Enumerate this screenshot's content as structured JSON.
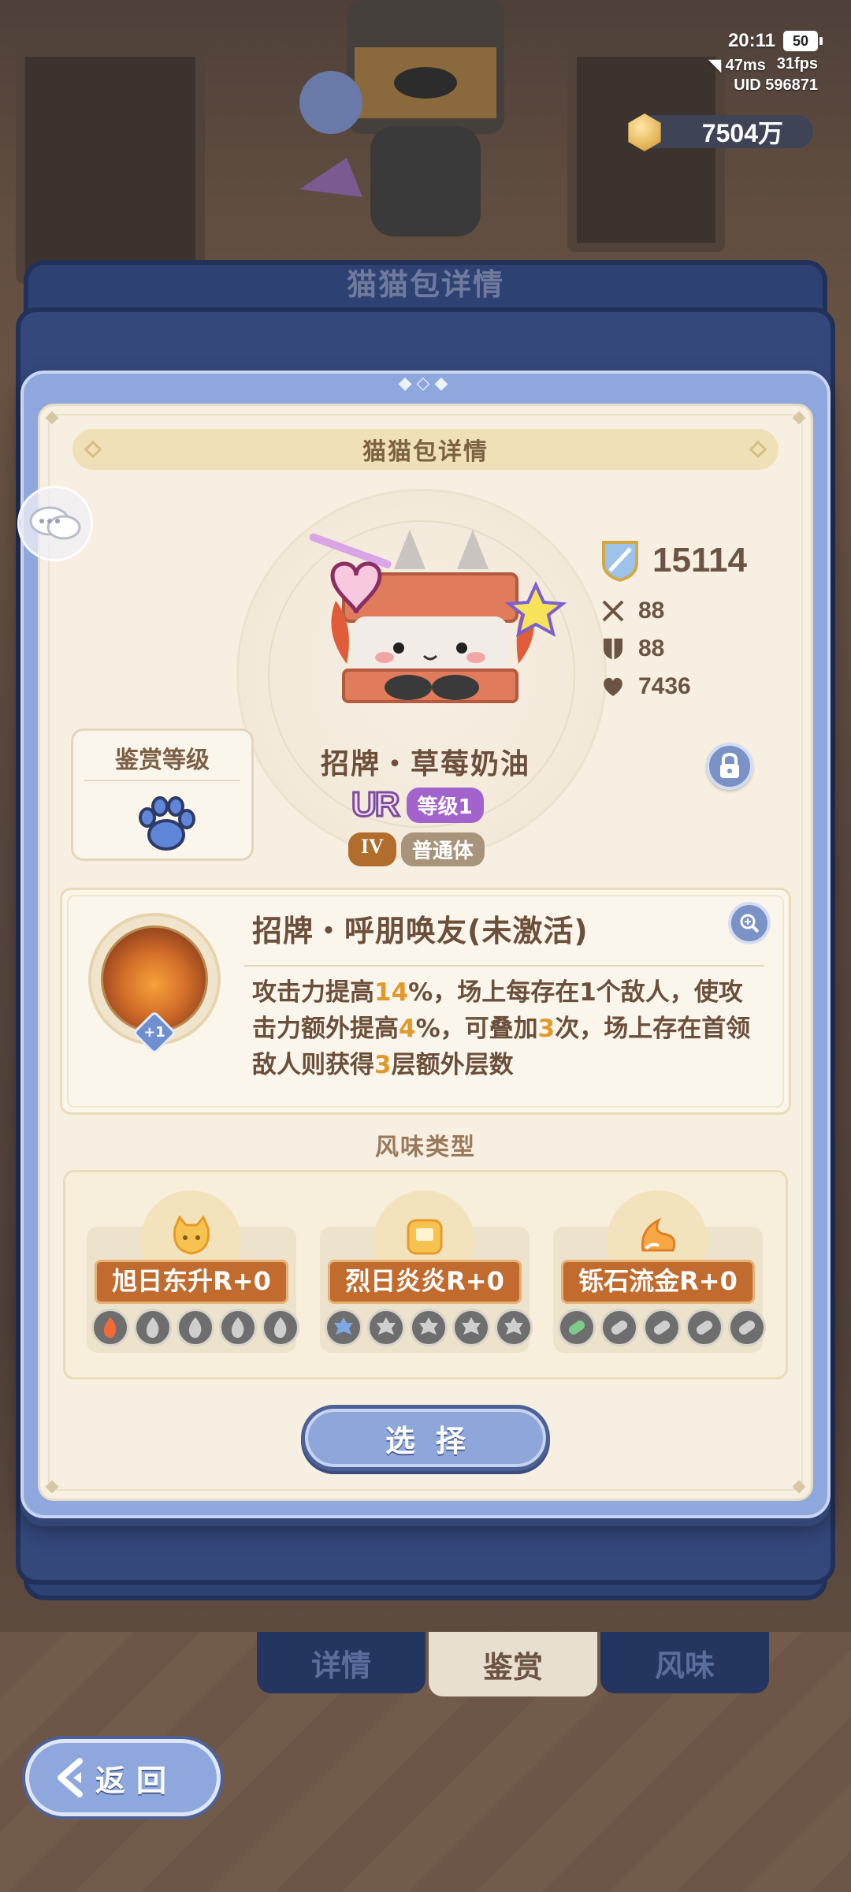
{
  "status": {
    "time": "20:11",
    "battery": "50",
    "ping": "47ms",
    "fps": "31fps",
    "uid": "UID 596871"
  },
  "currency": {
    "amount": "7504万",
    "icon": "gold-hex-coin-icon"
  },
  "background_panel": {
    "title": "猫猫包详情"
  },
  "panel": {
    "title": "猫猫包详情"
  },
  "cat": {
    "power": "15114",
    "attack": "88",
    "defense": "88",
    "hp": "7436",
    "name": "招牌・草莓奶油",
    "rarity": "UR",
    "level": "等级1",
    "rank": "IV",
    "body_type": "普通体"
  },
  "appreciation": {
    "label": "鉴赏等级",
    "icon": "blue-paw-icon"
  },
  "skill": {
    "title": "招牌・呼朋唤友(未激活)",
    "plus": "+1",
    "desc_parts": [
      {
        "t": "攻击力提高",
        "hl": false
      },
      {
        "t": "14",
        "hl": true
      },
      {
        "t": "%，场上每存在1个敌人，使攻击力额外提高",
        "hl": false
      },
      {
        "t": "4",
        "hl": true
      },
      {
        "t": "%，可叠加",
        "hl": false
      },
      {
        "t": "3",
        "hl": true
      },
      {
        "t": "次，场上存在首领敌人则获得",
        "hl": false
      },
      {
        "t": "3",
        "hl": true
      },
      {
        "t": "层额外层数",
        "hl": false
      }
    ]
  },
  "flavor": {
    "heading": "风味类型",
    "items": [
      {
        "name": "旭日东升R+0",
        "icon": "cat-face-icon",
        "dot_icon": "flame-icon"
      },
      {
        "name": "烈日炎炎R+0",
        "icon": "toast-icon",
        "dot_icon": "gear-star-icon"
      },
      {
        "name": "铄石流金R+0",
        "icon": "fox-tail-icon",
        "dot_icon": "pill-icon"
      }
    ]
  },
  "select_button": "选择",
  "tabs": [
    {
      "label": "详情",
      "active": false
    },
    {
      "label": "鉴赏",
      "active": true
    },
    {
      "label": "风味",
      "active": false
    }
  ],
  "back_button": "返回",
  "colors": {
    "panel_blue": "#8ea8dd",
    "panel_cream": "#f7efe1",
    "highlight_orange": "#e0992a",
    "plate_orange": "#c26b2e",
    "level_purple": "#a363cc"
  }
}
